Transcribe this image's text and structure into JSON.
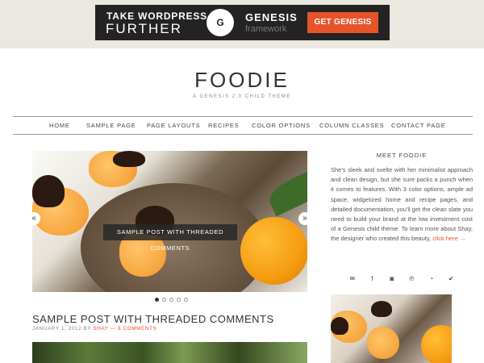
{
  "ad": {
    "line1": "TAKE WORDPRESS",
    "line2": "FURTHER",
    "logo_letter": "G",
    "brand": "GENESIS",
    "brand_sub": "framework",
    "cta": "GET GENESIS"
  },
  "site": {
    "title": "FOODIE",
    "tagline": "A GENESIS 2.0 CHILD THEME"
  },
  "nav": {
    "items": [
      {
        "label": "HOME"
      },
      {
        "label": "SAMPLE PAGE"
      },
      {
        "label": "PAGE LAYOUTS"
      },
      {
        "label": "RECIPES"
      },
      {
        "label": "COLOR OPTIONS"
      },
      {
        "label": "COLUMN CLASSES"
      },
      {
        "label": "CONTACT PAGE"
      }
    ]
  },
  "slider": {
    "prev": "«",
    "next": "»",
    "caption": "SAMPLE POST WITH THREADED COMMENTS",
    "slide_count": 5,
    "active_index": 0
  },
  "post": {
    "title": "SAMPLE POST WITH THREADED COMMENTS",
    "date": "JANUARY 1, 2012",
    "by": "BY",
    "author": "SHAY",
    "separator": "—",
    "comments": "8 COMMENTS"
  },
  "sidebar": {
    "widget_title": "MEET FOODIE",
    "text": "She's sleek and svelte with her minimalist approach and clean design, but she sure packs a punch when it comes to features. With 3 color options, ample ad space, widgetized home and recipe pages, and detailed documentation, you'll get the clean slate you need to build your brand at the low investment cost of a Genesis child theme. To learn more about Shay, the designer who created this beauty, ",
    "link": "click here →",
    "social": [
      {
        "icon": "email-icon",
        "glyph": "✉"
      },
      {
        "icon": "facebook-icon",
        "glyph": "f"
      },
      {
        "icon": "instagram-icon",
        "glyph": "◙"
      },
      {
        "icon": "pinterest-icon",
        "glyph": "℗"
      },
      {
        "icon": "rss-icon",
        "glyph": "◔"
      },
      {
        "icon": "twitter-icon",
        "glyph": "✔"
      }
    ]
  },
  "colors": {
    "accent": "#e8542a",
    "ad_bg": "#232323",
    "header_strip": "#ebe8e1"
  }
}
